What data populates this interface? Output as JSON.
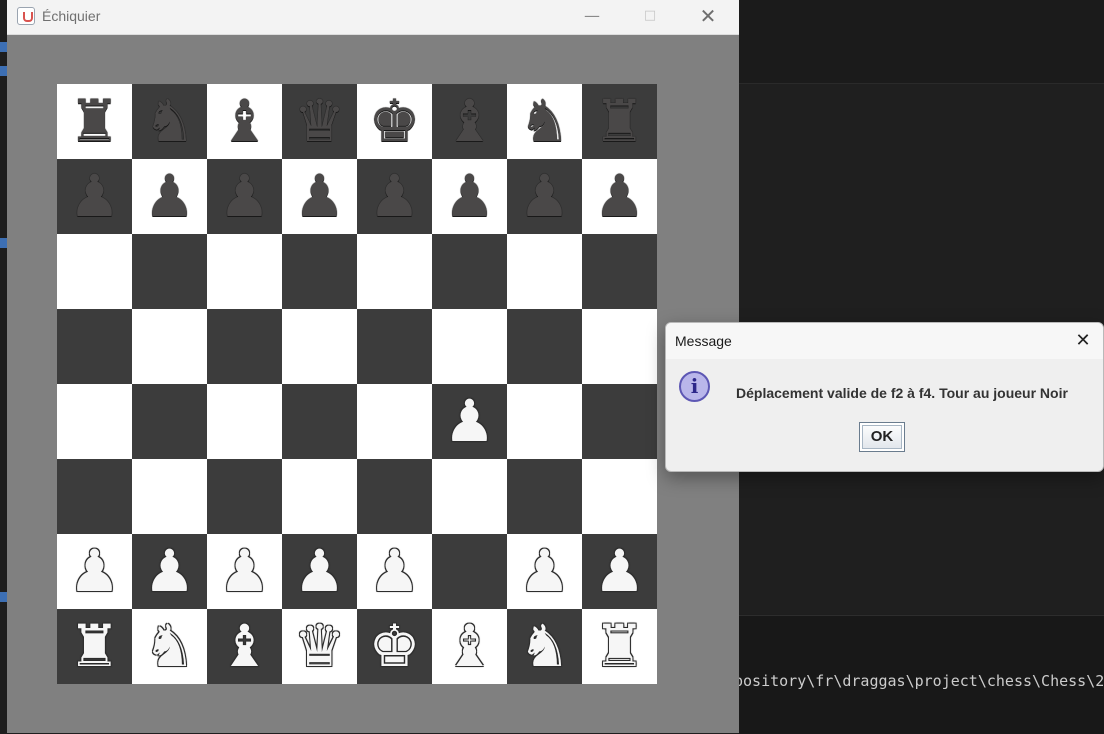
{
  "window": {
    "title": "Échiquier",
    "controls": {
      "minimize": "—",
      "maximize": "□",
      "close": "✕"
    }
  },
  "board": {
    "rows": [
      [
        {
          "p": "♜",
          "c": "black"
        },
        {
          "p": "♞",
          "c": "black"
        },
        {
          "p": "♝",
          "c": "black"
        },
        {
          "p": "♛",
          "c": "black"
        },
        {
          "p": "♚",
          "c": "black"
        },
        {
          "p": "♝",
          "c": "black"
        },
        {
          "p": "♞",
          "c": "black"
        },
        {
          "p": "♜",
          "c": "black"
        }
      ],
      [
        {
          "p": "♟",
          "c": "black"
        },
        {
          "p": "♟",
          "c": "black"
        },
        {
          "p": "♟",
          "c": "black"
        },
        {
          "p": "♟",
          "c": "black"
        },
        {
          "p": "♟",
          "c": "black"
        },
        {
          "p": "♟",
          "c": "black"
        },
        {
          "p": "♟",
          "c": "black"
        },
        {
          "p": "♟",
          "c": "black"
        }
      ],
      [
        {
          "p": "",
          "c": ""
        },
        {
          "p": "",
          "c": ""
        },
        {
          "p": "",
          "c": ""
        },
        {
          "p": "",
          "c": ""
        },
        {
          "p": "",
          "c": ""
        },
        {
          "p": "",
          "c": ""
        },
        {
          "p": "",
          "c": ""
        },
        {
          "p": "",
          "c": ""
        }
      ],
      [
        {
          "p": "",
          "c": ""
        },
        {
          "p": "",
          "c": ""
        },
        {
          "p": "",
          "c": ""
        },
        {
          "p": "",
          "c": ""
        },
        {
          "p": "",
          "c": ""
        },
        {
          "p": "",
          "c": ""
        },
        {
          "p": "",
          "c": ""
        },
        {
          "p": "",
          "c": ""
        }
      ],
      [
        {
          "p": "",
          "c": ""
        },
        {
          "p": "",
          "c": ""
        },
        {
          "p": "",
          "c": ""
        },
        {
          "p": "",
          "c": ""
        },
        {
          "p": "",
          "c": ""
        },
        {
          "p": "♟",
          "c": "white"
        },
        {
          "p": "",
          "c": ""
        },
        {
          "p": "",
          "c": ""
        }
      ],
      [
        {
          "p": "",
          "c": ""
        },
        {
          "p": "",
          "c": ""
        },
        {
          "p": "",
          "c": ""
        },
        {
          "p": "",
          "c": ""
        },
        {
          "p": "",
          "c": ""
        },
        {
          "p": "",
          "c": ""
        },
        {
          "p": "",
          "c": ""
        },
        {
          "p": "",
          "c": ""
        }
      ],
      [
        {
          "p": "♟",
          "c": "white"
        },
        {
          "p": "♟",
          "c": "white"
        },
        {
          "p": "♟",
          "c": "white"
        },
        {
          "p": "♟",
          "c": "white"
        },
        {
          "p": "♟",
          "c": "white"
        },
        {
          "p": "",
          "c": ""
        },
        {
          "p": "♟",
          "c": "white"
        },
        {
          "p": "♟",
          "c": "white"
        }
      ],
      [
        {
          "p": "♜",
          "c": "white"
        },
        {
          "p": "♞",
          "c": "white"
        },
        {
          "p": "♝",
          "c": "white"
        },
        {
          "p": "♛",
          "c": "white"
        },
        {
          "p": "♚",
          "c": "white"
        },
        {
          "p": "♝",
          "c": "white"
        },
        {
          "p": "♞",
          "c": "white"
        },
        {
          "p": "♜",
          "c": "white"
        }
      ]
    ],
    "colors": {
      "light": "#ffffff",
      "dark": "#3c3c3c"
    }
  },
  "dialog": {
    "title": "Message",
    "close": "✕",
    "icon": "info-icon",
    "icon_glyph": "i",
    "message": "Déplacement valide de f2 à f4. Tour au joueur Noir",
    "ok_label": "OK"
  },
  "background": {
    "terminal_path": "pository\\fr\\draggas\\project\\chess\\Chess\\2"
  }
}
